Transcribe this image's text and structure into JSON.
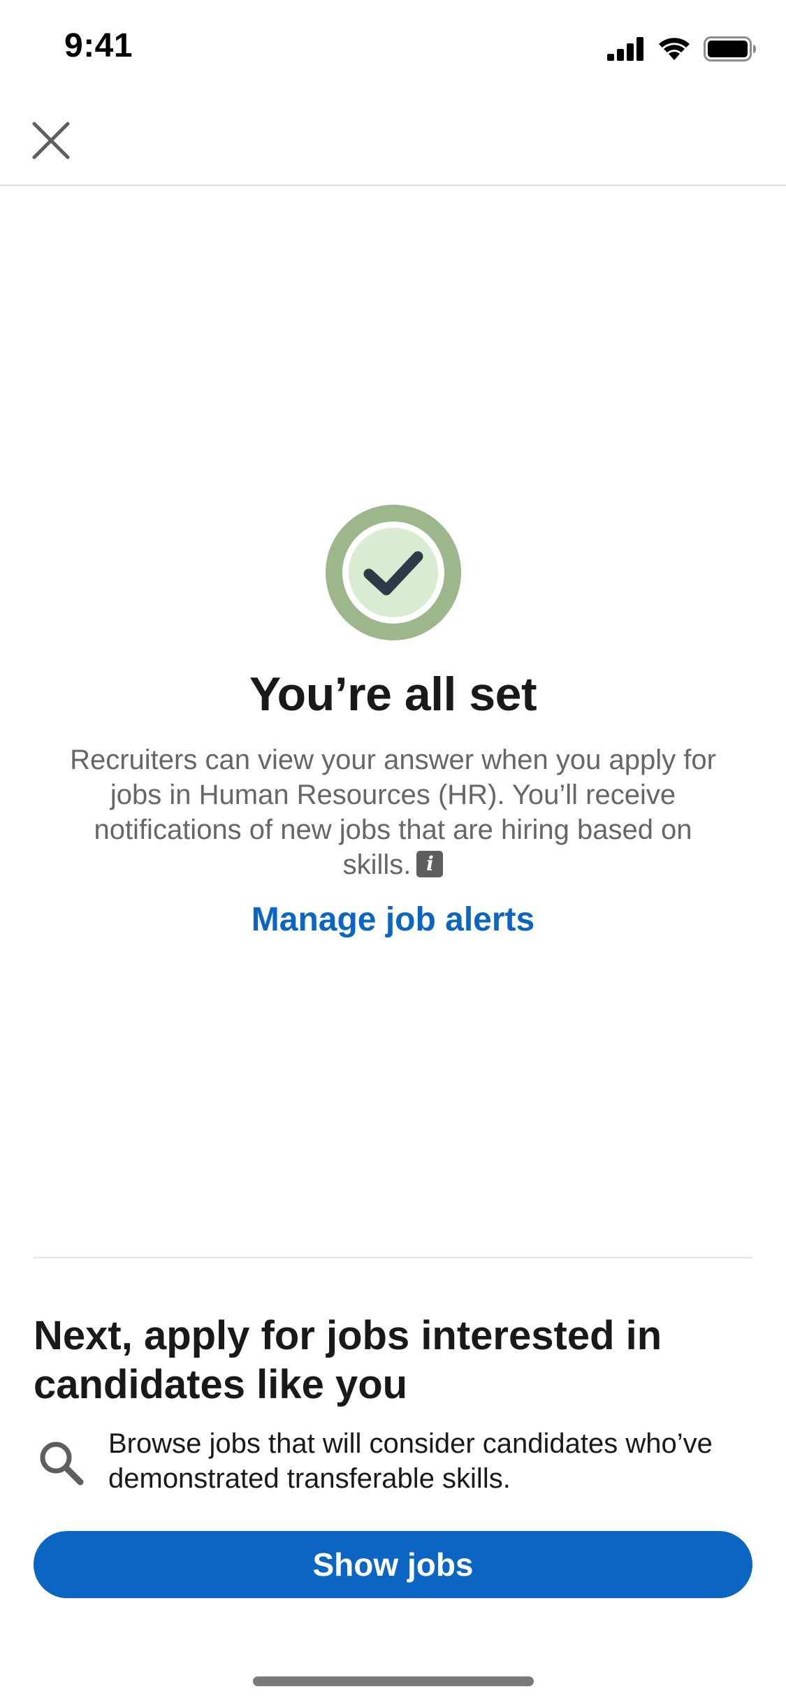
{
  "status_bar": {
    "time": "9:41",
    "icons": [
      "cellular-signal-icon",
      "wifi-icon",
      "battery-icon"
    ]
  },
  "header": {
    "close_icon": "close-icon"
  },
  "success": {
    "icon": "checkmark-icon",
    "title": "You’re all set",
    "body": "Recruiters can view your answer when you apply for jobs in Human Resources (HR). You’ll receive notifications of new jobs that are hiring based on skills.",
    "info_icon": "info-icon",
    "manage_link": "Manage job alerts"
  },
  "next": {
    "title": "Next, apply for jobs interested in candidates like you",
    "search_icon": "search-icon",
    "description": "Browse jobs that will consider candidates who’ve demonstrated transferable skills.",
    "button_label": "Show jobs"
  },
  "colors": {
    "primary": "#0a66c2",
    "badge_outer": "#9cb78c",
    "badge_inner": "#d8ecd2",
    "check": "#2d3a48"
  }
}
